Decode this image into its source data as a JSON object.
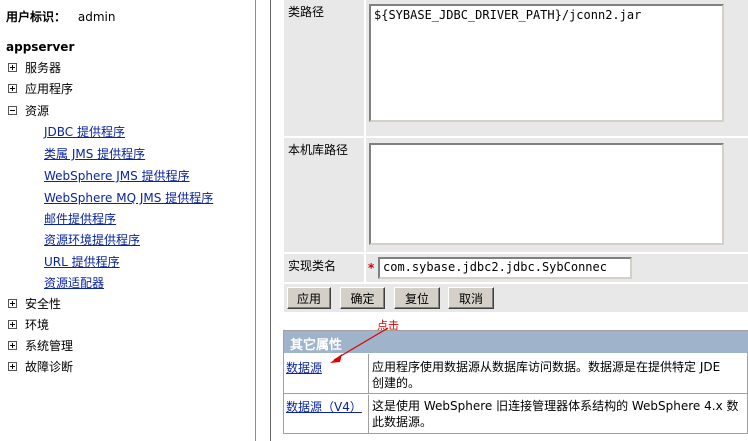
{
  "sidebar": {
    "user_label": "用户标识：",
    "user_value": "admin",
    "server": "appserver",
    "items": [
      {
        "label": "服务器",
        "expanded": false
      },
      {
        "label": "应用程序",
        "expanded": false
      },
      {
        "label": "资源",
        "expanded": true
      },
      {
        "label": "安全性",
        "expanded": false
      },
      {
        "label": "环境",
        "expanded": false
      },
      {
        "label": "系统管理",
        "expanded": false
      },
      {
        "label": "故障诊断",
        "expanded": false
      }
    ],
    "resources": [
      "JDBC 提供程序",
      "类属 JMS 提供程序",
      "WebSphere JMS 提供程序",
      "WebSphere MQ JMS 提供程序",
      "邮件提供程序",
      "资源环境提供程序",
      "URL 提供程序",
      "资源适配器"
    ]
  },
  "form": {
    "classpath_label": "类路径",
    "classpath_value": "${SYBASE_JDBC_DRIVER_PATH}/jconn2.jar",
    "native_label": "本机库路径",
    "native_value": "",
    "impl_label": "实现类名",
    "impl_required": "*",
    "impl_value": "com.sybase.jdbc2.jdbc.SybConnec"
  },
  "buttons": {
    "apply": "应用",
    "ok": "确定",
    "reset": "复位",
    "cancel": "取消"
  },
  "props": {
    "title": "其它属性",
    "annotation": "点击",
    "rows": [
      {
        "link": "数据源",
        "desc1": "应用程序使用数据源从数据库访问数据。数据源是在提供特定 JDE",
        "desc2": "创建的。"
      },
      {
        "link": "数据源（V4）",
        "desc1": "这是使用 WebSphere 旧连接管理器体系结构的 WebSphere 4.x 数",
        "desc2": "此数据源。"
      }
    ]
  },
  "colors": {
    "link": "#0a24a0",
    "section_header": "#9fb3cb",
    "annotation": "#e00000"
  }
}
